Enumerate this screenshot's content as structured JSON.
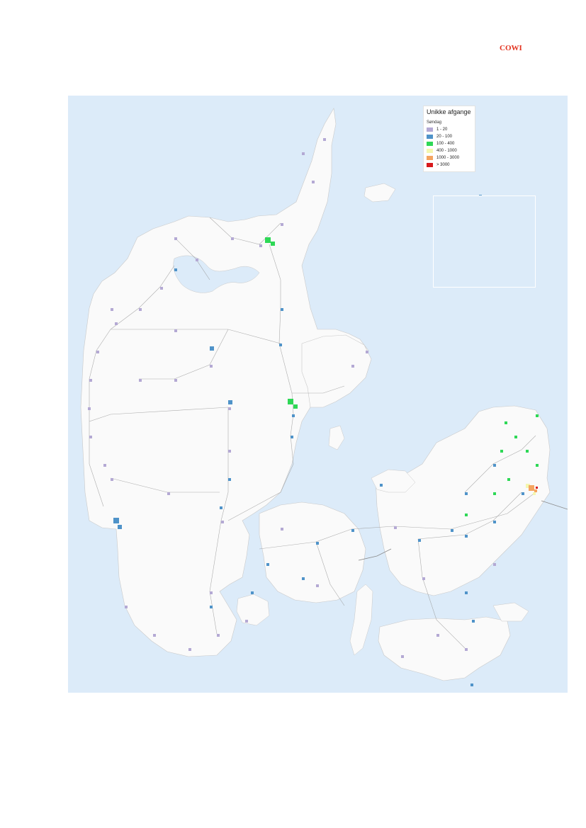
{
  "header": {
    "logo_text": "COWI"
  },
  "map": {
    "legend": {
      "title": "Unikke afgange",
      "subtitle": "Søndag",
      "items": [
        {
          "label": "1 - 20",
          "color": "#b4a9d4"
        },
        {
          "label": "20 - 100",
          "color": "#4f93c9"
        },
        {
          "label": "100 - 400",
          "color": "#2ed856"
        },
        {
          "label": "400 - 1000",
          "color": "#f4f7b0"
        },
        {
          "label": "1000 - 3000",
          "color": "#f4a561"
        },
        {
          "label": "> 3000",
          "color": "#d7191c"
        }
      ]
    },
    "colors": {
      "sea": "#dcebf9",
      "land": "#fafafa",
      "road": "#9a9a9a",
      "forest": "#d9e9cf"
    }
  }
}
